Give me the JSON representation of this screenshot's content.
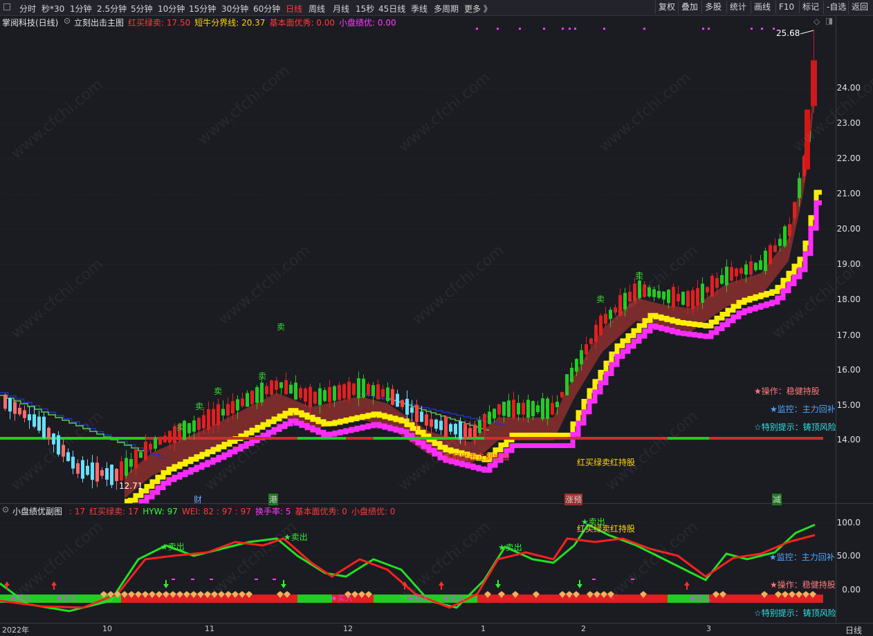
{
  "toolbar": {
    "periods": [
      "分时",
      "秒*30",
      "1分钟",
      "2.5分钟",
      "5分钟",
      "10分钟",
      "15分钟",
      "30分钟",
      "60分钟",
      "日线",
      "周线",
      "月线",
      "15秒",
      "45日线",
      "季线",
      "多周期",
      "更多 》"
    ],
    "active_period": "日线",
    "right_buttons": [
      "复权",
      "叠加",
      "多股",
      "统计",
      "画线",
      "F10",
      "标记",
      "-自选",
      "返回"
    ]
  },
  "main": {
    "stock_title": "掌阅科技(日线)",
    "indicator_name": "立刻出击主图",
    "params": [
      {
        "label": "红买绿卖: 17.50",
        "color": "#ff3c3c"
      },
      {
        "label": "短牛分界线: 20.37",
        "color": "#ffd700"
      },
      {
        "label": "基本面优秀: 0.00",
        "color": "#ff3c3c"
      },
      {
        "label": "小盘绩优: 0.00",
        "color": "#ff3cff"
      }
    ],
    "y_ticks": [
      "24.00",
      "23.00",
      "22.00",
      "21.00",
      "20.00",
      "19.00",
      "18.00",
      "17.00",
      "16.00",
      "15.00",
      "14.00"
    ],
    "high_label": "25.68",
    "low_label": "12.71",
    "signals": {
      "sell": "卖",
      "strike": "立刻出击立刻出击",
      "hold": "红买绿卖红持股"
    },
    "side_notes": [
      {
        "text": "★操作：稳健持股",
        "color": "#ff7a7a"
      },
      {
        "text": "★监控：主力回补",
        "color": "#4aa8ff"
      },
      {
        "text": "☆特别提示：铸顶风险",
        "color": "#33e0e0"
      }
    ],
    "event_marks": [
      {
        "text": "财",
        "color": "#6fa8ff"
      },
      {
        "text": "港",
        "color": "#ffffff"
      },
      {
        "text": "涨预",
        "color": "#ffffff"
      },
      {
        "text": "减",
        "color": "#ffffff"
      }
    ]
  },
  "sub": {
    "indicator_name": "小盘绩优副图",
    "params": [
      {
        "label": ": 17",
        "color": "#ff3c3c"
      },
      {
        "label": "红买绿卖: 17",
        "color": "#ff3c3c"
      },
      {
        "label": "HYW: 97",
        "color": "#33ff33"
      },
      {
        "label": "WEI: 82 : 97 : 97",
        "color": "#ff3c3c"
      },
      {
        "label": "换手率: 5",
        "color": "#ff3cff"
      },
      {
        "label": "基本面优秀: 0",
        "color": "#ff3c3c"
      },
      {
        "label": "小盘绩优: 0",
        "color": "#ff3c3c"
      }
    ],
    "y_ticks": [
      "100.0",
      "50.00",
      "0.00"
    ],
    "markers": {
      "sell": "★卖出",
      "buy": "买入",
      "hold": "红买绿卖红持股"
    },
    "side_notes": [
      {
        "text": "★监控：主力回补",
        "color": "#4aa8ff"
      },
      {
        "text": "★操作：稳健持股",
        "color": "#ff7a7a"
      },
      {
        "text": "☆特别提示：铸顶风险",
        "color": "#33e0e0"
      }
    ]
  },
  "time_axis": {
    "labels": [
      "2022年",
      "10",
      "11",
      "12",
      "1",
      "2",
      "3"
    ],
    "period": "日线"
  },
  "watermark": "www.cfchi.com"
}
